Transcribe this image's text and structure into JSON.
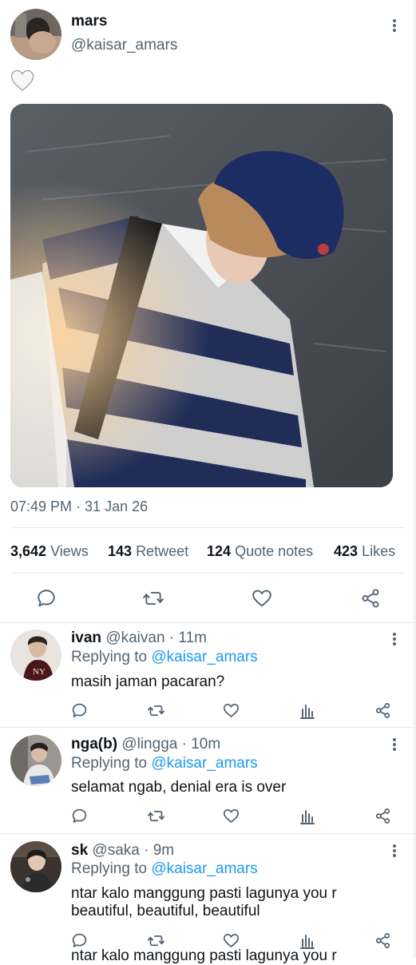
{
  "post": {
    "display_name": "mars",
    "handle": "@kaisar_amars",
    "emoji": "🤍",
    "timestamp": "07:49 PM · 31 Jan 26",
    "stats": {
      "views_count": "3,642",
      "views_label": "Views",
      "retweet_count": "143",
      "retweet_label": "Retweet",
      "quote_count": "124",
      "quote_label": "Quote notes",
      "likes_count": "423",
      "likes_label": "Likes"
    }
  },
  "replies": [
    {
      "name": "ivan",
      "meta": "@kaivan · 11m",
      "replying_prefix": "Replying to",
      "replying_to": "@kaisar_amars",
      "text": "masih jaman pacaran?"
    },
    {
      "name": "nga(b)",
      "meta": "@lingga · 10m",
      "replying_prefix": "Replying to",
      "replying_to": "@kaisar_amars",
      "text": "selamat ngab, denial era is over"
    },
    {
      "name": "sk",
      "meta": "@saka · 9m",
      "replying_prefix": "Replying to",
      "replying_to": "@kaisar_amars",
      "text_line1": "ntar kalo manggung pasti lagunya you r",
      "text_line2": "beautiful, beautiful, beautiful"
    }
  ],
  "cut_off_text": "ntar kalo manggung pasti lagunya you r",
  "colors": {
    "accent": "#1d9bf0",
    "secondary_text": "#536471",
    "divider": "#e6e9ec"
  }
}
